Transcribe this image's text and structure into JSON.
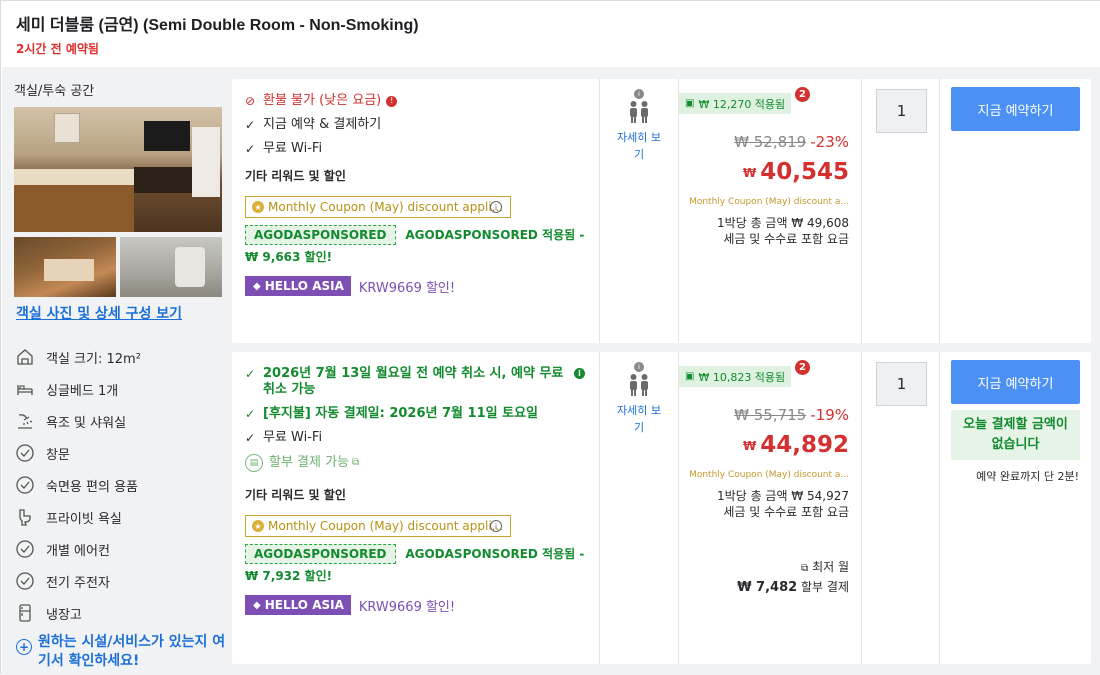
{
  "header": {
    "title": "세미 더블룸 (금연) (Semi Double Room - Non-Smoking)",
    "booked_note": "2시간 전 예약됨"
  },
  "room": {
    "section_label": "객실/투숙 공간",
    "photo_link": "객실 사진 및 상세 구성 보기",
    "amenities": [
      {
        "label": "객실 크기: 12m²",
        "icon": "room-size-icon"
      },
      {
        "label": "싱글베드 1개",
        "icon": "bed-icon"
      },
      {
        "label": "욕조 및 샤워실",
        "icon": "shower-icon"
      },
      {
        "label": "창문",
        "icon": "check-circle-icon"
      },
      {
        "label": "숙면용 편의 용품",
        "icon": "check-circle-icon"
      },
      {
        "label": "프라이빗 욕실",
        "icon": "toilet-icon"
      },
      {
        "label": "개별 에어컨",
        "icon": "check-circle-icon"
      },
      {
        "label": "전기 주전자",
        "icon": "check-circle-icon"
      },
      {
        "label": "냉장고",
        "icon": "fridge-icon"
      }
    ],
    "facility_prompt": "원하는 시설/서비스가 있는지 여기서 확인하세요!"
  },
  "offers": [
    {
      "policy": "환불 불가 (낮은 요금)",
      "features": [
        "지금 예약 & 결제하기",
        "무료 Wi-Fi"
      ],
      "rewards_title": "기타 리워드 및 할인",
      "coupon": "Monthly Coupon (May) discount appli...",
      "agoda_tag": "AGODASPONSORED",
      "agoda_text": "AGODASPONSORED 적용됨 - ₩ 9,663 할인!",
      "promo_tag": "HELLO ASIA",
      "promo_code": "KRW9669 할인!",
      "occupancy_link": "자세히 보기",
      "saved": "₩ 12,270 적용됨",
      "saved_badge": "2",
      "original_price": "₩ 52,819",
      "discount_pct": "-23%",
      "currency": "₩",
      "price": "40,545",
      "coupon_note": "Monthly Coupon (May) discount a...",
      "total_line1": "1박당 총 금액 ₩ 49,608",
      "total_line2": "세금 및 수수료 포함 요금",
      "qty": "1",
      "book_label": "지금 예약하기"
    },
    {
      "policy": "2026년 7월 13일 월요일 전 예약 취소 시, 예약 무료 취소 가능",
      "features": [
        "[후지불] 자동 결제일: 2026년 7월 11일 토요일",
        "무료 Wi-Fi"
      ],
      "installment": "할부 결제 가능",
      "rewards_title": "기타 리워드 및 할인",
      "coupon": "Monthly Coupon (May) discount appli...",
      "agoda_tag": "AGODASPONSORED",
      "agoda_text": "AGODASPONSORED 적용됨 - ₩ 7,932 할인!",
      "promo_tag": "HELLO ASIA",
      "promo_code": "KRW9669 할인!",
      "occupancy_link": "자세히 보기",
      "saved": "₩ 10,823 적용됨",
      "saved_badge": "2",
      "original_price": "₩ 55,715",
      "discount_pct": "-19%",
      "currency": "₩",
      "price": "44,892",
      "coupon_note": "Monthly Coupon (May) discount a...",
      "total_line1": "1박당 총 금액 ₩ 54,927",
      "total_line2": "세금 및 수수료 포함 요금",
      "monthly_label": "최저 월",
      "monthly_amount": "₩ 7,482",
      "monthly_suffix": "할부 결제",
      "qty": "1",
      "book_label": "지금 예약하기",
      "no_pay_today": "오늘 결제할 금액이 없습니다",
      "remaining": "예약 완료까지 단 2분!"
    }
  ],
  "colors": {
    "accent_blue": "#4a90f5",
    "price_red": "#d3302f",
    "green": "#128a2d",
    "purple": "#7d4fb4",
    "coupon_gold": "#c49a2b"
  }
}
